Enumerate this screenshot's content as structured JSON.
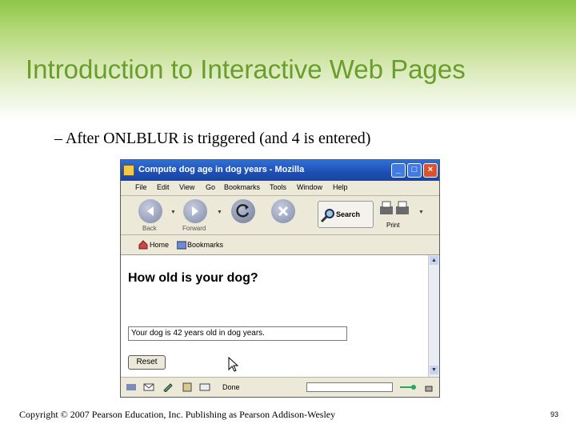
{
  "slide": {
    "title": "Introduction to Interactive Web Pages",
    "bullet": "– After ONLBLUR is triggered (and 4 is entered)",
    "copyright": "Copyright © 2007 Pearson Education, Inc. Publishing as Pearson Addison-Wesley",
    "page_number": "93"
  },
  "browser": {
    "window_title": "Compute dog age in dog years - Mozilla",
    "menu": [
      "File",
      "Edit",
      "View",
      "Go",
      "Bookmarks",
      "Tools",
      "Window",
      "Help"
    ],
    "toolbar": {
      "back_label": "Back",
      "forward_label": "Forward",
      "search_label": "Search",
      "print_label": "Print"
    },
    "bookmarks_bar": {
      "home_label": "Home",
      "bookmarks_label": "Bookmarks"
    },
    "status": "Done"
  },
  "page": {
    "heading": "How old is your dog?",
    "result_value": "Your dog is 42 years old in dog years.",
    "reset_label": "Reset"
  },
  "colors": {
    "title_green": "#6a9e2b",
    "titlebar_blue": "#1e4fb5"
  }
}
